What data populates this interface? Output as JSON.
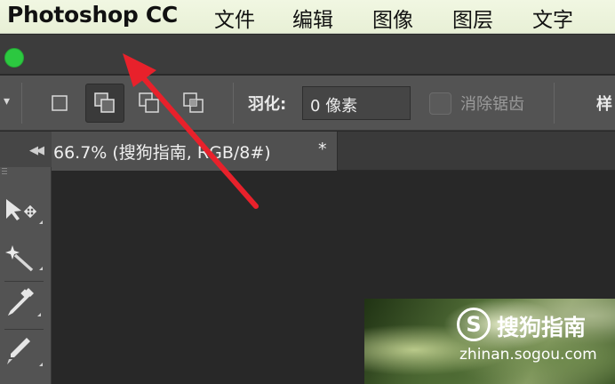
{
  "menubar": {
    "app_name": "Photoshop CC",
    "items": [
      "文件",
      "编辑",
      "图像",
      "图层",
      "文字"
    ]
  },
  "titlebar": {
    "controls": {
      "zoom_color": "#2cc840"
    }
  },
  "options_bar": {
    "feather_label": "羽化:",
    "feather_value": "0 像素",
    "anti_alias_label": "消除锯齿",
    "anti_alias_checked": false,
    "style_label": "样",
    "selection_modes": [
      "new-selection-icon",
      "add-to-selection-icon",
      "subtract-from-selection-icon",
      "intersect-selection-icon"
    ],
    "active_mode": "add-to-selection-icon"
  },
  "document": {
    "tab_label": "66.7% (搜狗指南, RGB/8#)",
    "close_label": "*"
  },
  "tools": [
    "path-selection-icon",
    "magic-wand-icon",
    "eyedropper-icon",
    "brush-icon"
  ],
  "watermark": {
    "logo_letter": "S",
    "name": "搜狗指南",
    "url": "zhinan.sogou.com"
  },
  "annotation": {
    "color": "#e8212b",
    "icon": "red-arrow-icon"
  }
}
